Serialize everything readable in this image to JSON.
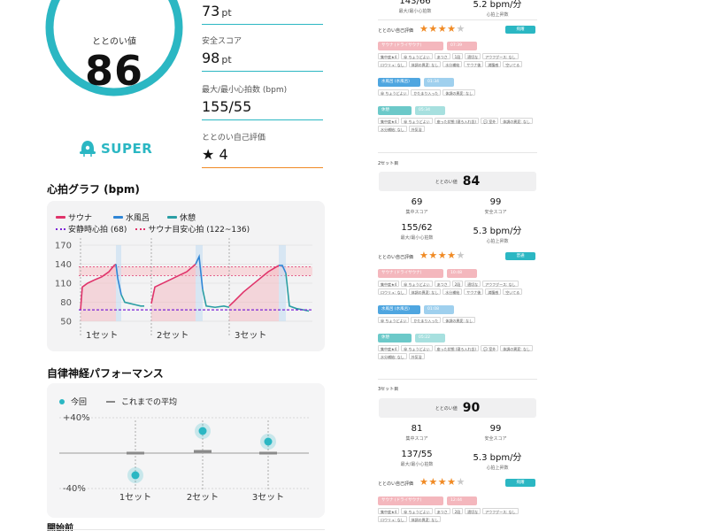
{
  "gauge": {
    "label": "ととのい値",
    "value": "86",
    "fill_fraction": 0.86,
    "accent": "#2bb7c3"
  },
  "rank": {
    "label": "SUPER"
  },
  "stats": [
    {
      "label": "",
      "value": "73",
      "unit": "pt"
    },
    {
      "label": "安全スコア",
      "value": "98",
      "unit": "pt"
    },
    {
      "label": "最大/最小心拍数 (bpm)",
      "value": "155/55",
      "unit": ""
    },
    {
      "label": "ととのい自己評価",
      "value": "4",
      "unit": "",
      "icon": "star-icon"
    }
  ],
  "heart_graph": {
    "title": "心拍グラフ (bpm)",
    "legend": [
      "サウナ",
      "水風呂",
      "休憩",
      "安静時心拍 (68)",
      "サウナ目安心拍 (122~136)"
    ],
    "colors": {
      "sauna": "#e0336a",
      "water": "#2f86d6",
      "rest": "#2a9ea4",
      "resting_line": "#7a22d6",
      "target_band": "#f7c2c9"
    },
    "chart_data": {
      "type": "line",
      "yticks": [
        "170",
        "140",
        "110",
        "80",
        "50"
      ],
      "ylim": [
        50,
        170
      ],
      "sets": [
        "1セット",
        "2セット",
        "3セット"
      ],
      "resting_hr": 68,
      "target_band": [
        122,
        136
      ]
    }
  },
  "autonomic": {
    "title": "自律神経パフォーマンス",
    "legend": [
      "今回",
      "これまでの平均"
    ],
    "chart_data": {
      "type": "scatter",
      "yticks": [
        "+40%",
        "-40%"
      ],
      "ylim": [
        -40,
        40
      ],
      "categories": [
        "1セット",
        "2セット",
        "3セット"
      ],
      "series": [
        {
          "name": "今回",
          "values": [
            -25,
            25,
            13
          ]
        },
        {
          "name": "これまでの平均",
          "values": [
            0,
            2,
            0
          ]
        }
      ]
    }
  },
  "before_start": {
    "title": "開始前"
  },
  "right": {
    "top_stats": [
      {
        "value": "143/66",
        "label": "最大/最小心拍数"
      },
      {
        "value": "5.2 bpm/分",
        "label": "心拍上昇数"
      }
    ],
    "set1": {
      "eval_label": "ととのい自己評価",
      "stars": [
        1,
        1,
        1,
        1,
        0
      ],
      "badge": "飛躍",
      "steps": [
        {
          "type": "sauna",
          "tag": "サウナ (ドライサウナ)",
          "time": "07:39",
          "chips": [
            "集中度★4",
            "😀 ちょうどよい",
            "あつさ",
            "1段",
            "適切な",
            "アウフグース: なし",
            "ロウリュ: なし",
            "体調の異変: なし",
            "水分補給",
            "サウナ後",
            "満腹感",
            "空いてる"
          ]
        },
        {
          "type": "water",
          "tag": "水風呂 (水風呂)",
          "time": "01:34",
          "chips": [
            "😀 ちょうどよい",
            "かたまり入った",
            "体調の異変: なし"
          ]
        },
        {
          "type": "rest",
          "tag": "休憩",
          "time": "05:34",
          "chips": [
            "集中度★4",
            "😀 ちょうどよい",
            "座った状態 (寝ろ入れ含)",
            "💬 室外",
            "体調の異変: なし",
            "水分補給: なし",
            "外気浴"
          ]
        }
      ]
    },
    "set2": {
      "title": "2セット目",
      "score_label": "ととのい値",
      "score": "84",
      "stats": [
        {
          "value": "69",
          "label": "集中スコア"
        },
        {
          "value": "99",
          "label": "安全スコア"
        },
        {
          "value": "155/62",
          "label": "最大/最小心拍数"
        },
        {
          "value": "5.3 bpm/分",
          "label": "心拍上昇数"
        }
      ],
      "eval_label": "ととのい自己評価",
      "stars": [
        1,
        1,
        1,
        1,
        0
      ],
      "badge": "普通",
      "steps": [
        {
          "type": "sauna",
          "tag": "サウナ (ドライサウナ)",
          "time": "10:48",
          "chips": [
            "集中度★4",
            "😀 ちょうどよい",
            "あつさ",
            "2段",
            "適切な",
            "アウフグース: なし",
            "ロウリュ: なし",
            "体調の異変: なし",
            "水分補給",
            "サウナ後",
            "満腹感",
            "空いてる"
          ]
        },
        {
          "type": "water",
          "tag": "水風呂 (水風呂)",
          "time": "01:08",
          "chips": [
            "😀 ちょうどよい",
            "かたまり入った",
            "体調の異変: なし"
          ]
        },
        {
          "type": "rest",
          "tag": "休憩",
          "time": "05:22",
          "chips": [
            "集中度★4",
            "😀 ちょうどよい",
            "座った状態 (寝ろ入れ含)",
            "💬 室外",
            "体調の異変: なし",
            "水分補給: なし",
            "外気浴"
          ]
        }
      ]
    },
    "set3": {
      "title": "3セット目",
      "score_label": "ととのい値",
      "score": "90",
      "stats": [
        {
          "value": "81",
          "label": "集中スコア"
        },
        {
          "value": "99",
          "label": "安全スコア"
        },
        {
          "value": "137/55",
          "label": "最大/最小心拍数"
        },
        {
          "value": "5.3 bpm/分",
          "label": "心拍上昇数"
        }
      ],
      "eval_label": "ととのい自己評価",
      "stars": [
        1,
        1,
        1,
        1,
        0
      ],
      "badge": "飛躍",
      "steps": [
        {
          "type": "sauna",
          "tag": "サウナ (ドライサウナ)",
          "time": "12:44",
          "chips": [
            "集中度★4",
            "😀 ちょうどよい",
            "あつさ",
            "2段",
            "適切な",
            "アウフグース: なし",
            "ロウリュ: なし",
            "体調の異変: なし"
          ]
        }
      ]
    }
  }
}
